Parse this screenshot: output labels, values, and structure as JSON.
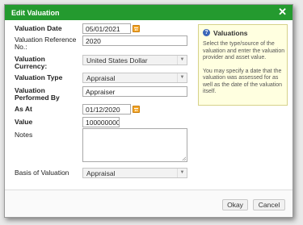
{
  "dialog": {
    "title": "Edit Valuation"
  },
  "form": {
    "valuation_date_label": "Valuation Date",
    "valuation_date_value": "05/01/2021",
    "valuation_reference_label_1": "Valuation Reference",
    "valuation_reference_label_2": "No.:",
    "valuation_reference_value": "2020",
    "valuation_currency_label_1": "Valuation",
    "valuation_currency_label_2": "Currency:",
    "valuation_currency_value": "United States Dollar",
    "valuation_type_label": "Valuation Type",
    "valuation_type_value": "Appraisal",
    "valuation_performed_by_label_1": "Valuation",
    "valuation_performed_by_label_2": "Performed By",
    "valuation_performed_by_value": "Appraiser",
    "as_at_label": "As At",
    "as_at_value": "01/12/2020",
    "value_label": "Value",
    "value_value": "100000000",
    "notes_label": "Notes",
    "notes_value": "",
    "basis_label": "Basis of Valuation",
    "basis_value": "Appraisal"
  },
  "help": {
    "title": "Valuations",
    "paragraph_1": "Select the type/source of the valuation and enter the valuation provider and asset value.",
    "paragraph_2": "You may specify a date that the valuation was assessed for as well as the date of the valuation itself."
  },
  "buttons": {
    "ok": "Okay",
    "cancel": "Cancel"
  },
  "colors": {
    "titlebar": "#249a2f",
    "calendar_icon": "#f4a72a",
    "help_background": "#ffffe0"
  },
  "icons": {
    "close": "close-icon",
    "calendar": "calendar-icon",
    "help": "help-icon",
    "dropdown": "chevron-down-icon"
  }
}
